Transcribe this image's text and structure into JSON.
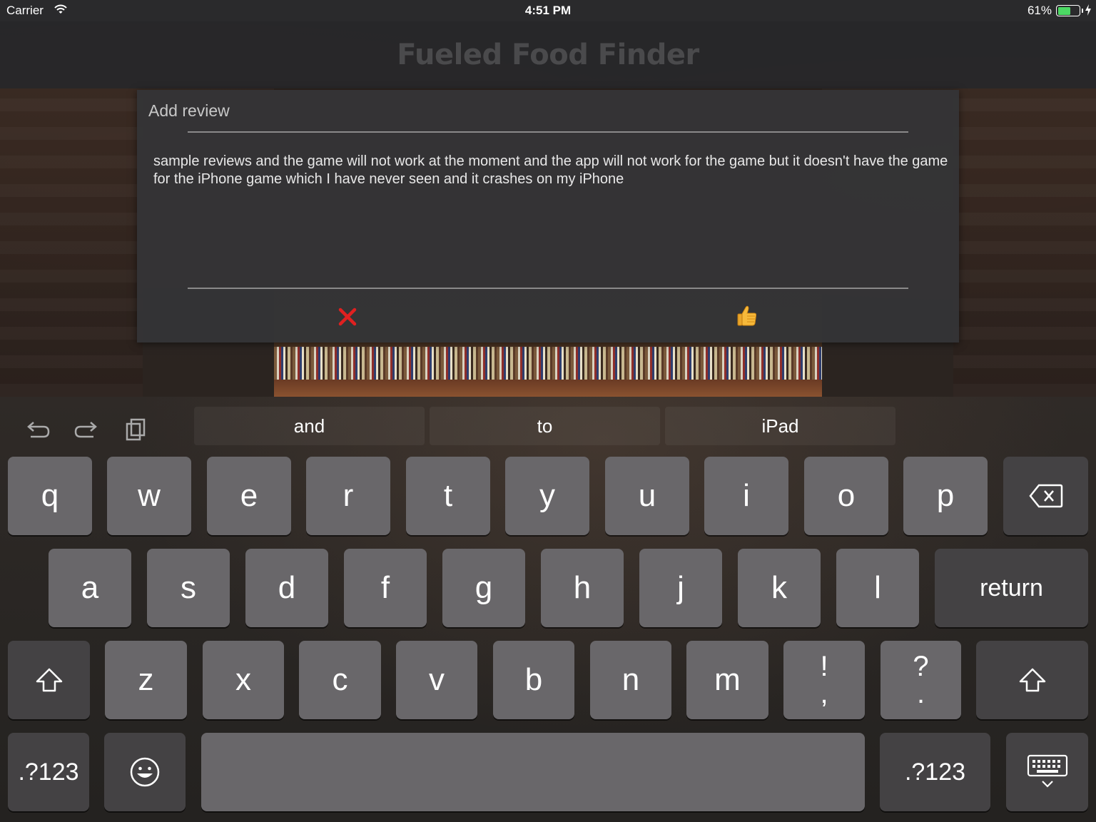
{
  "status_bar": {
    "carrier": "Carrier",
    "time": "4:51 PM",
    "battery_percent": "61%",
    "battery_level": 0.61,
    "battery_color": "#4cd964"
  },
  "app": {
    "title": "Fueled Food Finder"
  },
  "dialog": {
    "title": "Add review",
    "review_text": "sample reviews and the game will not work at the moment and the app will not work for the game but it doesn't have the game for the iPhone game which I have never seen and it crashes on my iPhone",
    "cancel_icon": "close-x-icon",
    "submit_icon": "thumbs-up-icon",
    "cancel_color": "#e02020"
  },
  "keyboard": {
    "tools": [
      "undo-icon",
      "redo-icon",
      "paste-icon"
    ],
    "suggestions": [
      "and",
      "to",
      "iPad"
    ],
    "row1": [
      "q",
      "w",
      "e",
      "r",
      "t",
      "y",
      "u",
      "i",
      "o",
      "p"
    ],
    "row2": [
      "a",
      "s",
      "d",
      "f",
      "g",
      "h",
      "j",
      "k",
      "l"
    ],
    "row3": [
      "z",
      "x",
      "c",
      "v",
      "b",
      "n",
      "m"
    ],
    "punct1": {
      "top": "!",
      "bottom": ","
    },
    "punct2": {
      "top": "?",
      "bottom": "."
    },
    "return_label": "return",
    "numbers_label": ".?123"
  }
}
